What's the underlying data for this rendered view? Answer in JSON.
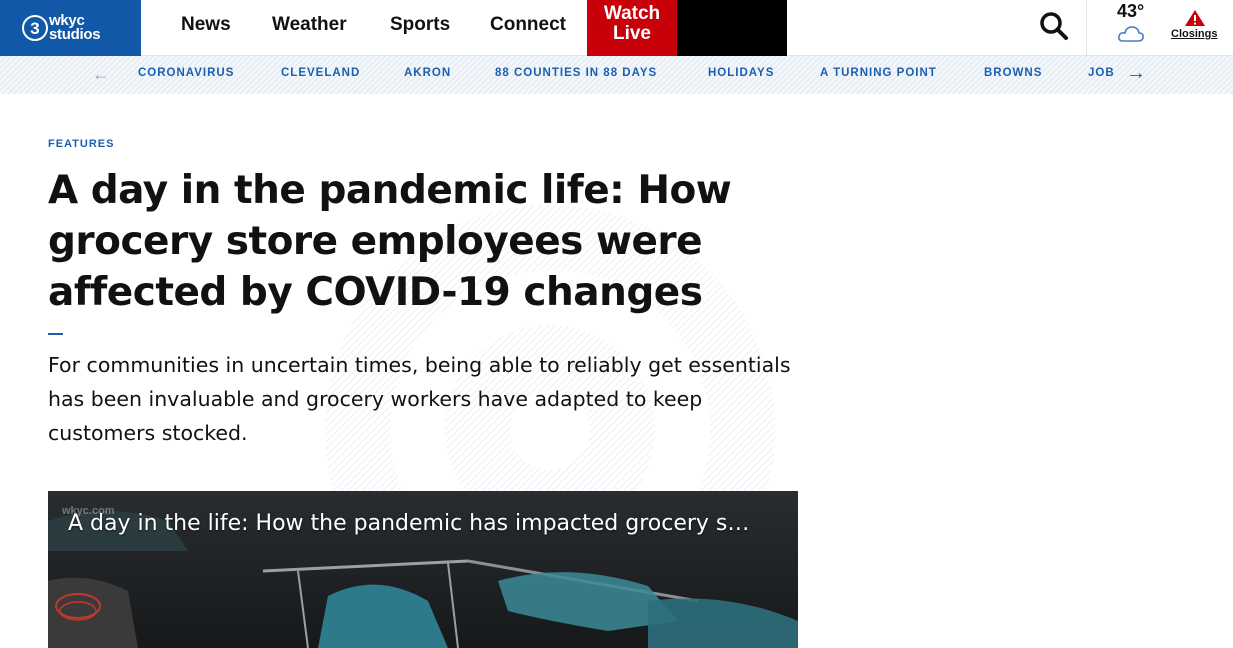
{
  "header": {
    "logo_number": "3",
    "logo_line1": "wkyc",
    "logo_line2": "studios",
    "nav": [
      "News",
      "Weather",
      "Sports",
      "Connect"
    ],
    "watch_live_line1": "Watch",
    "watch_live_line2": "Live",
    "search_icon": "search-icon",
    "temperature": "43°",
    "weather_icon": "cloud-icon",
    "alert_icon": "warning-triangle-icon",
    "closings_label": "Closings"
  },
  "subnav": {
    "items": [
      "CORONAVIRUS",
      "CLEVELAND",
      "AKRON",
      "88 COUNTIES IN 88 DAYS",
      "HOLIDAYS",
      "A TURNING POINT",
      "BROWNS",
      "JOB"
    ],
    "prev_icon": "arrow-left-icon",
    "next_icon": "arrow-right-icon"
  },
  "article": {
    "kicker": "FEATURES",
    "headline": "A day in the pandemic life: How grocery store employees were affected by COVID-19 changes",
    "summary": "For communities in uncertain times, being able to reliably get essentials has been invaluable and grocery workers have adapted to keep customers stocked."
  },
  "video": {
    "watermark": "wkyc.com",
    "title": "A day in the life: How the pandemic has impacted grocery s…"
  },
  "colors": {
    "brand_blue": "#1258a8",
    "link_blue": "#1a5fb0",
    "live_red": "#c8000a"
  }
}
